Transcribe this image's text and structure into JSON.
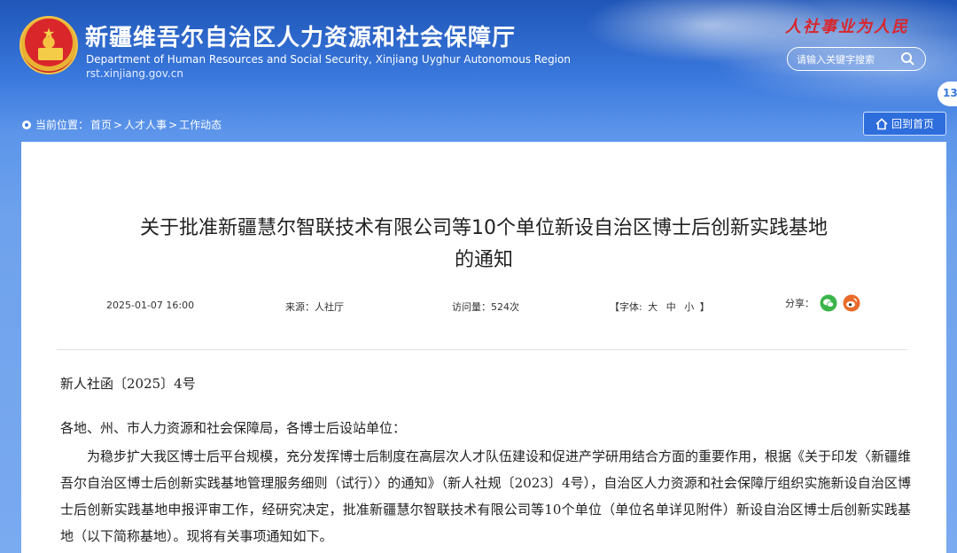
{
  "header": {
    "site_title": "新疆维吾尔自治区人力资源和社会保障厅",
    "site_subtitle": "Department of Human Resources and Social Security, Xinjiang Uyghur Autonomous Region",
    "site_url": "rst.xinjiang.gov.cn",
    "slogan": "人社事业为人民",
    "search_placeholder": "请输入关键字搜索",
    "side_tab": "13"
  },
  "breadcrumb": {
    "label": "当前位置：",
    "items": [
      "首页",
      ">",
      "人才人事",
      ">",
      "工作动态"
    ]
  },
  "home_button": "回到首页",
  "article": {
    "title_line1": "关于批准新疆慧尔智联技术有限公司等10个单位新设自治区博士后创新实践基地",
    "title_line2": "的通知",
    "date": "2025-01-07 16:00",
    "source": "来源：人社厅",
    "views": "访问量：524次",
    "font_label_open": "【字体:",
    "font_large": "大",
    "font_medium": "中",
    "font_small": "小",
    "font_label_close": "】",
    "share_label": "分享：",
    "doc_number": "新人社函〔2025〕4号",
    "addressee": "各地、州、市人力资源和社会保障局，各博士后设站单位：",
    "paragraph1": "为稳步扩大我区博士后平台规模，充分发挥博士后制度在高层次人才队伍建设和促进产学研用结合方面的重要作用，根据《关于印发〈新疆维吾尔自治区博士后创新实践基地管理服务细则（试行）〉的通知》（新人社规〔2023〕4号），自治区人力资源和社会保障厅组织实施新设自治区博士后创新实践基地申报评审工作，经研究决定，批准新疆慧尔智联技术有限公司等10个单位（单位名单详见附件）新设自治区博士后创新实践基地（以下简称基地）。现将有关事项通知如下。"
  },
  "colors": {
    "header_blue": "#1f56b8",
    "slogan_red": "#d8262d",
    "wechat_green": "#3bb54a",
    "weibo_orange": "#e96b2a"
  }
}
